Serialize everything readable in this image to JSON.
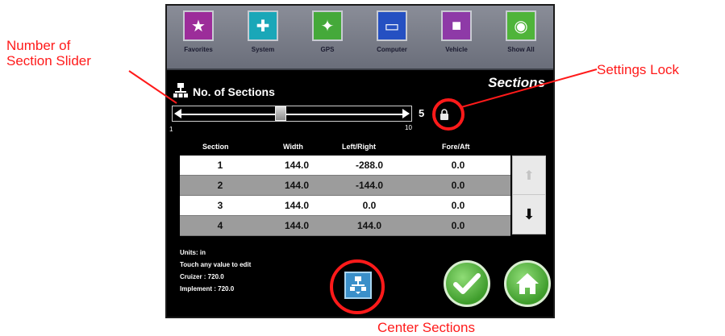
{
  "callouts": {
    "slider_line1": "Number of",
    "slider_line2": "Section Slider",
    "settings_lock": "Settings Lock",
    "center_sections": "Center Sections"
  },
  "toolbar": {
    "items": [
      {
        "label": "Favorites",
        "icon": "star-icon",
        "color": "#9c2d9a"
      },
      {
        "label": "System",
        "icon": "system-tools-icon",
        "color": "#1aa7b8"
      },
      {
        "label": "GPS",
        "icon": "gps-satellite-icon",
        "color": "#45a93a"
      },
      {
        "label": "Computer",
        "icon": "computer-icon",
        "color": "#2550c2"
      },
      {
        "label": "Vehicle",
        "icon": "vehicle-icon",
        "color": "#8e3aa7"
      },
      {
        "label": "Show All",
        "icon": "globe-icon",
        "color": "#4fb43a"
      }
    ]
  },
  "screen": {
    "title": "Sections",
    "section_label": "No. of Sections"
  },
  "slider": {
    "value": "5",
    "min": "1",
    "max": "10"
  },
  "table": {
    "headers": {
      "section": "Section",
      "width": "Width",
      "left_right": "Left/Right",
      "fore_aft": "Fore/Aft"
    },
    "rows": [
      {
        "section": "1",
        "width": "144.0",
        "left_right": "-288.0",
        "fore_aft": "0.0"
      },
      {
        "section": "2",
        "width": "144.0",
        "left_right": "-144.0",
        "fore_aft": "0.0"
      },
      {
        "section": "3",
        "width": "144.0",
        "left_right": "0.0",
        "fore_aft": "0.0"
      },
      {
        "section": "4",
        "width": "144.0",
        "left_right": "144.0",
        "fore_aft": "0.0"
      }
    ]
  },
  "info": {
    "units": "Units: in",
    "hint": "Touch any value to edit",
    "cruizer": "Cruizer : 720.0",
    "implement": "Implement : 720.0"
  },
  "colors": {
    "annotation_red": "#ff1a1a",
    "accept_green": "#4caf33",
    "center_blue": "#3a8fc9"
  }
}
